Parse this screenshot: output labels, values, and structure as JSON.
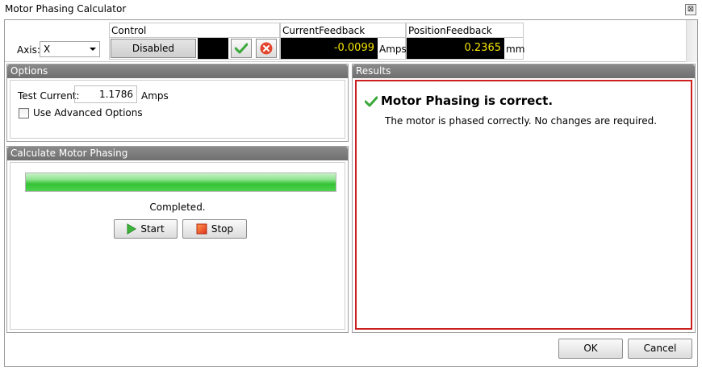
{
  "window": {
    "title": "Motor Phasing Calculator",
    "close_glyph": "⊠"
  },
  "axis": {
    "label": "Axis:",
    "selected": "X"
  },
  "control": {
    "header": "Control",
    "state_button": "Disabled",
    "enable_icon": "check-icon",
    "disable_icon": "cancel-icon"
  },
  "current_feedback": {
    "header": "CurrentFeedback",
    "value": "-0.0099",
    "unit": "Amps"
  },
  "position_feedback": {
    "header": "PositionFeedback",
    "value": "0.2365",
    "unit": "mm"
  },
  "options": {
    "header": "Options",
    "test_current_label": "Test Current:",
    "test_current_value": "1.1786",
    "test_current_unit": "Amps",
    "advanced_label": "Use Advanced Options",
    "advanced_checked": false
  },
  "calc": {
    "header": "Calculate Motor Phasing",
    "progress": 1.0,
    "status": "Completed.",
    "start_label": "Start",
    "stop_label": "Stop"
  },
  "results": {
    "header": "Results",
    "title": "Motor Phasing is correct.",
    "message": "The motor is phased correctly. No changes are required."
  },
  "footer": {
    "ok_label": "OK",
    "cancel_label": "Cancel"
  },
  "colors": {
    "readout_text": "#f5e400",
    "readout_bg": "#000000",
    "success_green": "#3aa83a",
    "result_border": "#cc1f1f",
    "panel_header": "#7a7a7a"
  }
}
